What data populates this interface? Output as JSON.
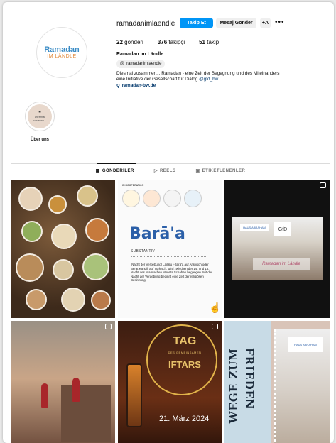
{
  "profile": {
    "username": "ramadanimlaendle",
    "follow_label": "Takip Et",
    "message_label": "Mesaj Gönder",
    "add_user_label": "+A",
    "more_label": "•••",
    "posts_count": "22",
    "posts_label": "gönderi",
    "followers_count": "376",
    "followers_label": "takipçi",
    "following_count": "51",
    "following_label": "takip",
    "full_name": "Ramadan im Ländle",
    "threads_handle": "ramadanimlaendle",
    "bio_line1": "Diesmal zusammen... Ramadan - eine Zeit der Begegnung und des Miteinanders",
    "bio_line2": "eine Initiative der Gesellschaft für Dialog",
    "bio_mention": "@gfd_bw",
    "link": "ramadan-bw.de",
    "avatar_text_1": "Ramadan",
    "avatar_text_2": "IM LÄNDLE"
  },
  "highlight": {
    "label": "Über uns",
    "inner_line1": "Diesmal",
    "inner_line2": "zusamm..."
  },
  "tabs": [
    {
      "label": "GÖNDERİLER",
      "icon": "grid-icon"
    },
    {
      "label": "REELS",
      "icon": "reels-icon"
    },
    {
      "label": "ETİKETLENENLER",
      "icon": "tag-icon"
    }
  ],
  "posts": {
    "p2_coop": "IN KOOPERATION",
    "p2_title": "Barā'a",
    "p2_subtitle": "SUBSTANTIV",
    "p2_text": "[Nacht der Vergebung] Lailatu l-Barā'a auf Arabisch oder Berat Kandili auf Türkisch, wird zwischen der 14. und 15. Nacht des islamischen Monats Schaban begangen. Mit der Nacht der Vergebung beginnt eine Zeit der religiösen Besinnung.",
    "p3_sign1": "HAUS ABRAHAM",
    "p3_sign2": "GfD",
    "p3_caption": "Ramadan im Ländle",
    "p5_line1": "TAG",
    "p5_line2": "DES GEMEINSAMEN",
    "p5_line3": "IFTARS",
    "p5_date": "21. März 2024",
    "p6_word1": "WEGE ZUM",
    "p6_word2": "FRIEDEN",
    "p6_sign": "HAUS ABRAHAM"
  },
  "colors": {
    "accent": "#0095f6",
    "link": "#00376b"
  }
}
